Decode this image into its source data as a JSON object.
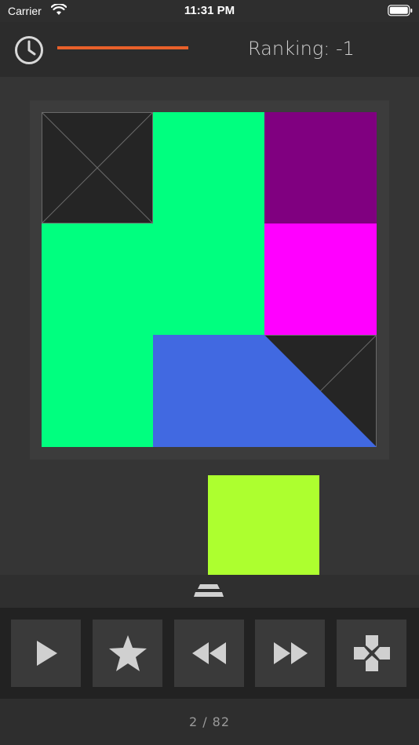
{
  "status_bar": {
    "carrier": "Carrier",
    "time": "11:31 PM",
    "wifi_icon": "wifi-icon",
    "battery_icon": "battery-icon"
  },
  "header": {
    "ranking": "Ranking: -1",
    "clock_icon": "clock-icon",
    "timer_color": "#e8602a",
    "timer_progress": 1.0
  },
  "board": {
    "grid_size": 3,
    "cell_colors": {
      "empty": "#252525",
      "green": "#00ff7f",
      "purple": "#800080",
      "magenta": "#ff00ff",
      "blue": "#4169e1"
    }
  },
  "tray": {
    "piece_color": "#adff2f"
  },
  "toolbar": {
    "buttons": [
      "play-icon",
      "star-icon",
      "rewind-icon",
      "fast-forward-icon",
      "gamepad-icon"
    ]
  },
  "footer": {
    "level": "2 / 82"
  }
}
